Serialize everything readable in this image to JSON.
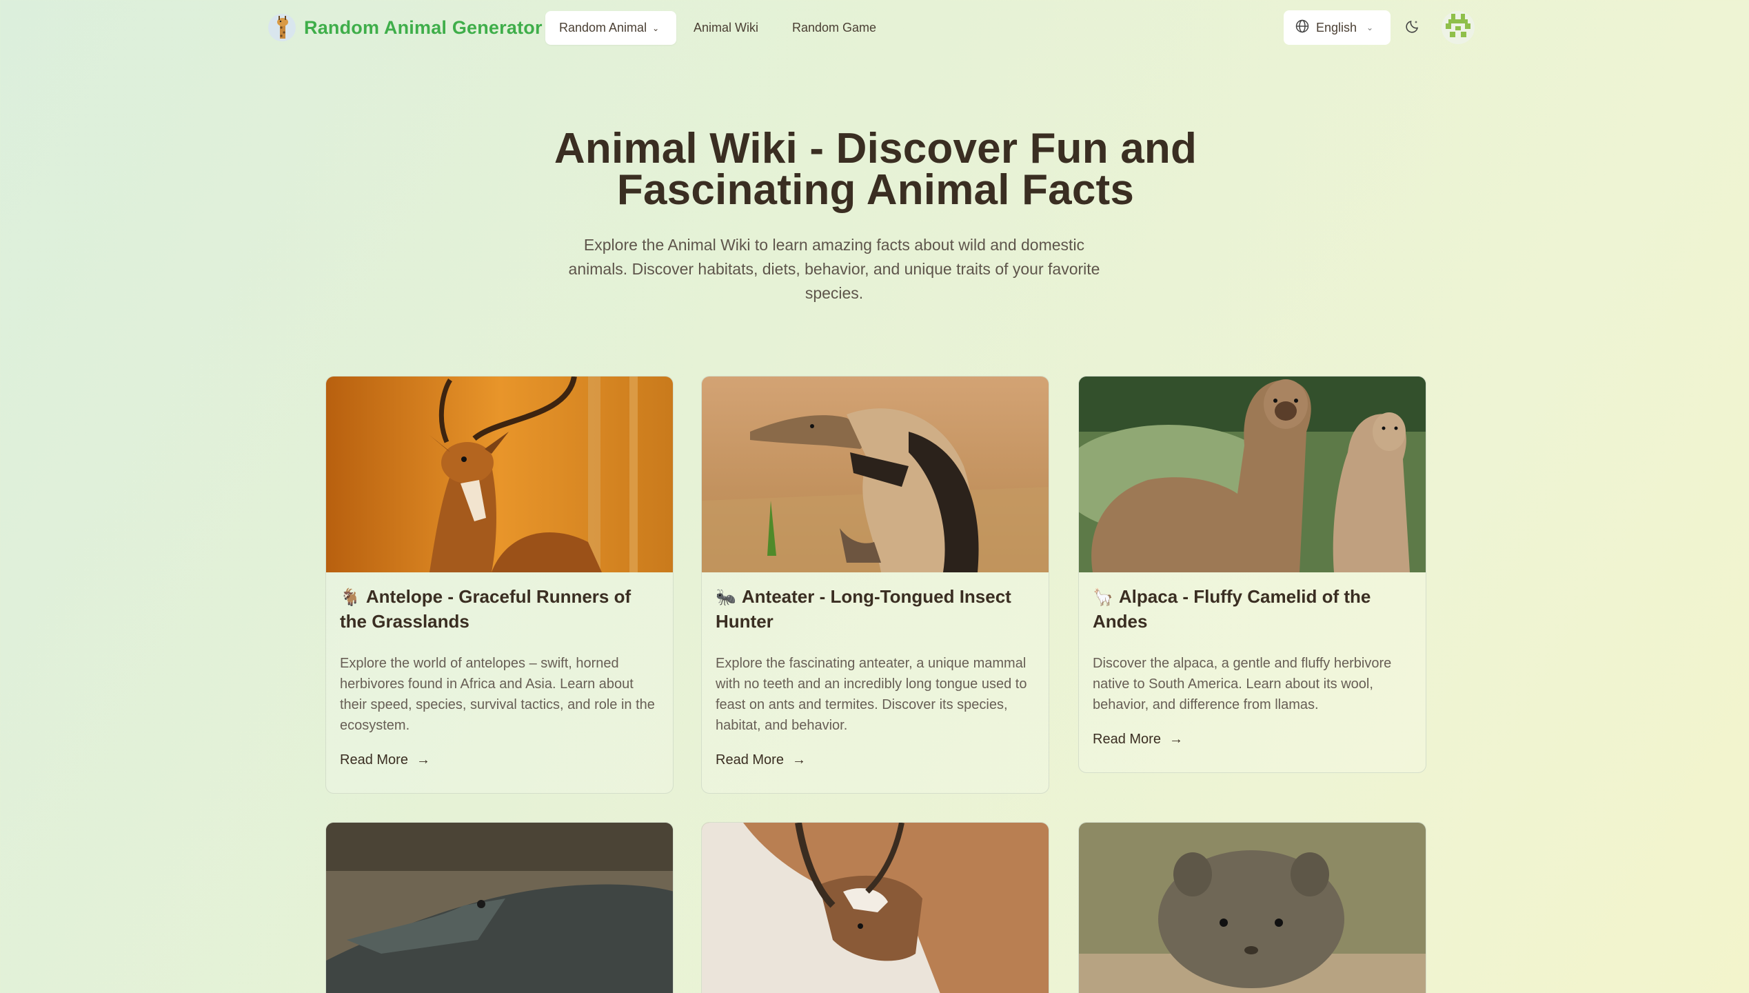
{
  "nav": {
    "brand": "Random Animal Generator",
    "random_animal": "Random Animal",
    "animal_wiki": "Animal Wiki",
    "random_game": "Random Game",
    "language": "English"
  },
  "hero": {
    "title_line1": "Animal Wiki - Discover Fun and",
    "title_line2": "Fascinating Animal Facts",
    "subtitle_line1": "Explore the Animal Wiki to learn amazing facts about wild and domestic",
    "subtitle_line2": "animals. Discover habitats, diets, behavior, and unique traits of your favorite",
    "subtitle_line3": "species."
  },
  "cards": [
    {
      "emoji": "🐐",
      "title": "Antelope - Graceful Runners of the Grasslands",
      "description": "Explore the world of antelopes – swift, horned herbivores found in Africa and Asia. Learn about their speed, species, survival tactics, and role in the ecosystem.",
      "link": "Read More"
    },
    {
      "emoji": "🐜",
      "title": "Anteater - Long-Tongued Insect Hunter",
      "description": "Explore the fascinating anteater, a unique mammal with no teeth and an incredibly long tongue used to feast on ants and termites. Discover its species, habitat, and behavior.",
      "link": "Read More"
    },
    {
      "emoji": "🦙",
      "title": "Alpaca - Fluffy Camelid of the Andes",
      "description": "Discover the alpaca, a gentle and fluffy herbivore native to South America. Learn about its wool, behavior, and difference from llamas.",
      "link": "Read More"
    }
  ],
  "icons": {
    "globe": "globe-icon",
    "moon": "moon-icon",
    "arrow": "arrow-right-icon",
    "chevron": "chevron-down-icon"
  },
  "colors": {
    "brand": "#3fae4a",
    "text": "#3a2e22"
  }
}
